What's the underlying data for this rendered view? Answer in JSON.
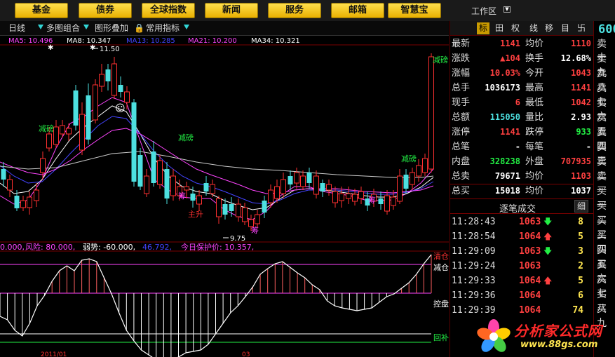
{
  "top_menu": {
    "items": [
      "基金",
      "债券",
      "全球指数",
      "新闻",
      "服务",
      "邮箱",
      "智慧宝"
    ],
    "workspace_label": "工作区"
  },
  "toolbar": {
    "period": "日线",
    "multi_chart": "多图组合",
    "overlay": "图形叠加",
    "common_indicators": "常用指标"
  },
  "main_chart": {
    "ma_legend": [
      {
        "label": "MA5: 10.496",
        "color": "#ff44ff"
      },
      {
        "label": "MA8: 10.347",
        "color": "#ffffff"
      },
      {
        "label": "MA13: 10.285",
        "color": "#4444ff"
      },
      {
        "label": "MA21: 10.200",
        "color": "#ff44ff"
      },
      {
        "label": "MA34: 10.321",
        "color": "#ffffff"
      }
    ],
    "high_label": "11.50",
    "low_label": "9.75",
    "annotations": {
      "jianbang_1": "减磅",
      "jianbang_2": "减磅",
      "jianbang_3": "减磅",
      "jianbang_4": "减磅",
      "zhusheng": "主升",
      "chou_1": "筹",
      "chou_2": "筹",
      "chou_3": "筹"
    }
  },
  "sub_chart": {
    "legend": [
      {
        "label": "0.000,",
        "color": "#ff44ff"
      },
      {
        "label": "风险: 80.000,",
        "color": "#ff44ff"
      },
      {
        "label": "弱势: -60.000,",
        "color": "#ffffff"
      },
      {
        "label": "46.792,",
        "color": "#4444ff"
      },
      {
        "label": "今日保护价: 10.357,",
        "color": "#ff44ff"
      }
    ],
    "labels": {
      "qingcang": "清仓",
      "jiancang": "减仓",
      "kongpan": "控盘",
      "huibu": "回补"
    },
    "date_labels": [
      "2011/01",
      "03"
    ]
  },
  "right_panel": {
    "tabs": [
      "标",
      "田",
      "权",
      "线",
      "移",
      "目",
      "卐"
    ],
    "quote": [
      {
        "l1": "最新",
        "v1": "1141",
        "c1": "red",
        "l2": "均价",
        "v2": "1110",
        "c2": "red"
      },
      {
        "l1": "涨跌",
        "v1": "▲104",
        "c1": "red",
        "l2": "换手",
        "v2": "12.68%",
        "c2": "white"
      },
      {
        "l1": "涨幅",
        "v1": "10.03%",
        "c1": "red",
        "l2": "今开",
        "v2": "1043",
        "c2": "red"
      },
      {
        "l1": "总手",
        "v1": "1036173",
        "c1": "white",
        "l2": "最高",
        "v2": "1141",
        "c2": "red"
      },
      {
        "l1": "现手",
        "v1": "6",
        "c1": "red",
        "l2": "最低",
        "v2": "1042",
        "c2": "red"
      },
      {
        "l1": "总额",
        "v1": "115050",
        "c1": "cyan",
        "l2": "量比",
        "v2": "2.93",
        "c2": "white"
      },
      {
        "l1": "涨停",
        "v1": "1141",
        "c1": "red",
        "l2": "跌停",
        "v2": "933",
        "c2": "green"
      },
      {
        "l1": "总笔",
        "v1": "-",
        "c1": "white",
        "l2": "每笔",
        "v2": "-",
        "c2": "white"
      },
      {
        "l1": "内盘",
        "v1": "328238",
        "c1": "green",
        "l2": "外盘",
        "v2": "707935",
        "c2": "red"
      },
      {
        "l1": "总卖",
        "v1": "79671",
        "c1": "white",
        "l2": "均价",
        "v2": "1103",
        "c2": "red"
      },
      {
        "l1": "总买",
        "v1": "15018",
        "c1": "white",
        "l2": "均价",
        "v2": "1037",
        "c2": "white"
      }
    ],
    "trades_title": "逐笔成交",
    "trades_detail": "细",
    "trades": [
      {
        "time": "11:28:43",
        "price": "1063",
        "dir": "down",
        "vol": "8"
      },
      {
        "time": "11:28:54",
        "price": "1064",
        "dir": "up",
        "vol": "5"
      },
      {
        "time": "11:29:09",
        "price": "1063",
        "dir": "down",
        "vol": "3"
      },
      {
        "time": "11:29:24",
        "price": "1063",
        "dir": "none",
        "vol": "2"
      },
      {
        "time": "11:29:33",
        "price": "1064",
        "dir": "up",
        "vol": "5"
      },
      {
        "time": "11:29:36",
        "price": "1064",
        "dir": "none",
        "vol": "6"
      },
      {
        "time": "11:29:39",
        "price": "1064",
        "dir": "none",
        "vol": "74"
      }
    ]
  },
  "book_column": {
    "code": "600",
    "levels": [
      "卖十",
      "卖九",
      "卖八",
      "卖七",
      "卖六",
      "卖五",
      "卖四",
      "卖三",
      "卖二",
      "卖一",
      "买一",
      "买二",
      "买三",
      "买四",
      "买五",
      "买六",
      "买七",
      "买八",
      "买九"
    ]
  },
  "watermark": {
    "title": "分析家公式网",
    "url": "www.88gs.com"
  },
  "colors": {
    "up": "#ff4040",
    "down": "#4de0e0",
    "grid": "#7a0000",
    "accent": "#ffd21a"
  }
}
